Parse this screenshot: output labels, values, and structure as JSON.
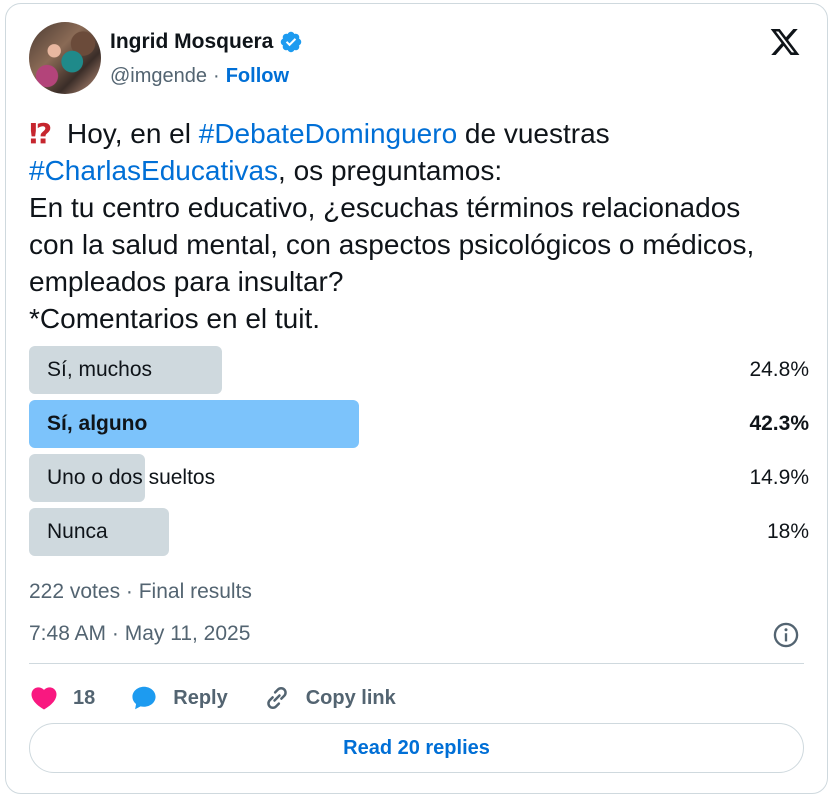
{
  "author": {
    "name": "Ingrid Mosquera",
    "handle": "@imgende",
    "separator": "·",
    "follow_label": "Follow"
  },
  "tweet": {
    "emoji": "⁉",
    "segments": [
      {
        "text": " Hoy, en el ",
        "type": "text"
      },
      {
        "text": "#DebateDominguero",
        "type": "hashtag"
      },
      {
        "text": " de vuestras\n",
        "type": "text"
      },
      {
        "text": "#CharlasEducativas",
        "type": "hashtag"
      },
      {
        "text": ", os preguntamos:\nEn tu centro educativo, ¿escuchas términos relacionados\ncon la salud mental, con aspectos psicológicos o médicos,\nempleados para insultar?\n*Comentarios en el tuit.",
        "type": "text"
      }
    ]
  },
  "poll": {
    "options": [
      {
        "label": "Sí, muchos",
        "percent_label": "24.8%",
        "percent": 24.8,
        "winner": false
      },
      {
        "label": "Sí, alguno",
        "percent_label": "42.3%",
        "percent": 42.3,
        "winner": true
      },
      {
        "label": "Uno o dos sueltos",
        "percent_label": "14.9%",
        "percent": 14.9,
        "winner": false
      },
      {
        "label": "Nunca",
        "percent_label": "18%",
        "percent": 18,
        "winner": false
      }
    ],
    "summary": "222 votes · Final results"
  },
  "timestamp": "7:48 AM · May 11, 2025",
  "actions": {
    "like_count": "18",
    "reply_label": "Reply",
    "copy_link_label": "Copy link"
  },
  "read_replies_label": "Read 20 replies",
  "colors": {
    "accent": "#006fd6",
    "verified": "#1d9bf0",
    "like": "#f91880",
    "reply": "#1d9bf0",
    "bar_winner": "#7cc3fb",
    "bar_default": "#cfd9de"
  }
}
